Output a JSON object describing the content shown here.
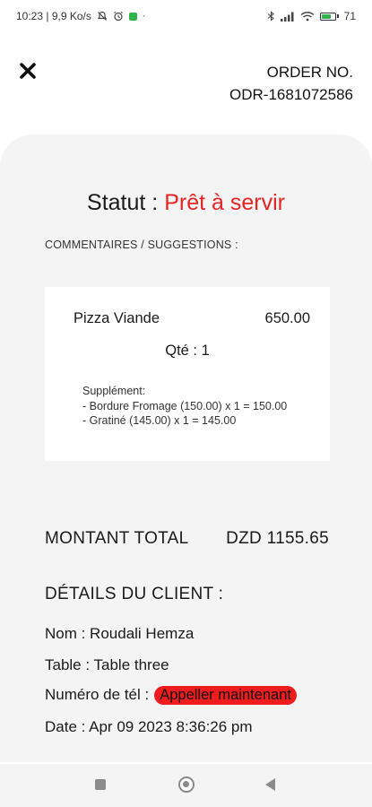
{
  "status_bar": {
    "time_speed": "10:23 | 9,9 Ko/s",
    "dot": "·",
    "battery_label": "71",
    "battery_level": 0.71,
    "icons": [
      "mute-icon",
      "alarm-icon",
      "app-notification-icon",
      "bluetooth-icon",
      "signal-icon",
      "wifi-icon",
      "battery-icon"
    ]
  },
  "header": {
    "close_icon": "close-icon",
    "order_label": "ORDER NO.",
    "order_number": "ODR-1681072586"
  },
  "order": {
    "statut_label": "Statut : ",
    "statut_value": "Prêt à servir",
    "statut_color": "#e62424",
    "comments_label": "COMMENTAIRES / SUGGESTIONS :",
    "item": {
      "name": "Pizza Viande",
      "price": "650.00",
      "qty": "Qté : 1",
      "supplement_title": "Supplément:",
      "supplements": [
        "- Bordure Fromage (150.00) x 1 = 150.00",
        "- Gratiné (145.00) x 1 = 145.00"
      ]
    },
    "total_label": "MONTANT TOTAL",
    "total_value": "DZD 1155.65"
  },
  "client": {
    "heading": "DÉTAILS DU CLIENT :",
    "name": "Nom : Roudali Hemza",
    "table": "Table : Table three",
    "phone_label": "Numéro de tél :",
    "call_button": "Appeller maintenant",
    "call_button_color": "#ee1c1c",
    "date": "Date : Apr 09 2023 8:36:26 pm"
  },
  "nav": {
    "recents_icon": "square-icon",
    "home_icon": "circle-icon",
    "back_icon": "back-triangle-icon"
  }
}
